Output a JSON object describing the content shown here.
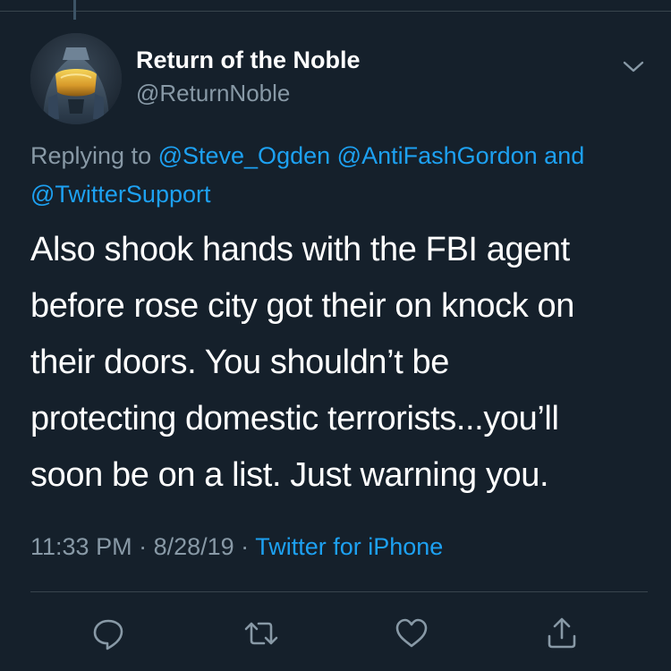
{
  "tweet": {
    "author": {
      "display_name": "Return of the Noble",
      "handle": "@ReturnNoble",
      "avatar_icon": "spartan-helmet-avatar"
    },
    "reply": {
      "prefix": "Replying to ",
      "mention_1": "@Steve_Ogden",
      "mention_2": "@AntiFashGordon",
      "conjunction": " and",
      "mention_3": "@TwitterSupport"
    },
    "text_lines": [
      "Also shook hands with the FBI agent",
      "before rose city got their on knock on",
      "their doors. You shouldn’t be",
      "protecting domestic terrorists...you’ll",
      "soon be on a list. Just warning you."
    ],
    "meta": {
      "time": "11:33 PM",
      "separator_1": " · ",
      "date": "8/28/19",
      "separator_2": " · ",
      "source": "Twitter for iPhone"
    },
    "actions": {
      "reply_icon": "reply-icon",
      "retweet_icon": "retweet-icon",
      "like_icon": "like-icon",
      "share_icon": "share-icon"
    }
  },
  "colors": {
    "background": "#15202b",
    "text_primary": "#ffffff",
    "text_secondary": "#8899a6",
    "accent": "#1da1f2",
    "divider": "#38444d"
  }
}
